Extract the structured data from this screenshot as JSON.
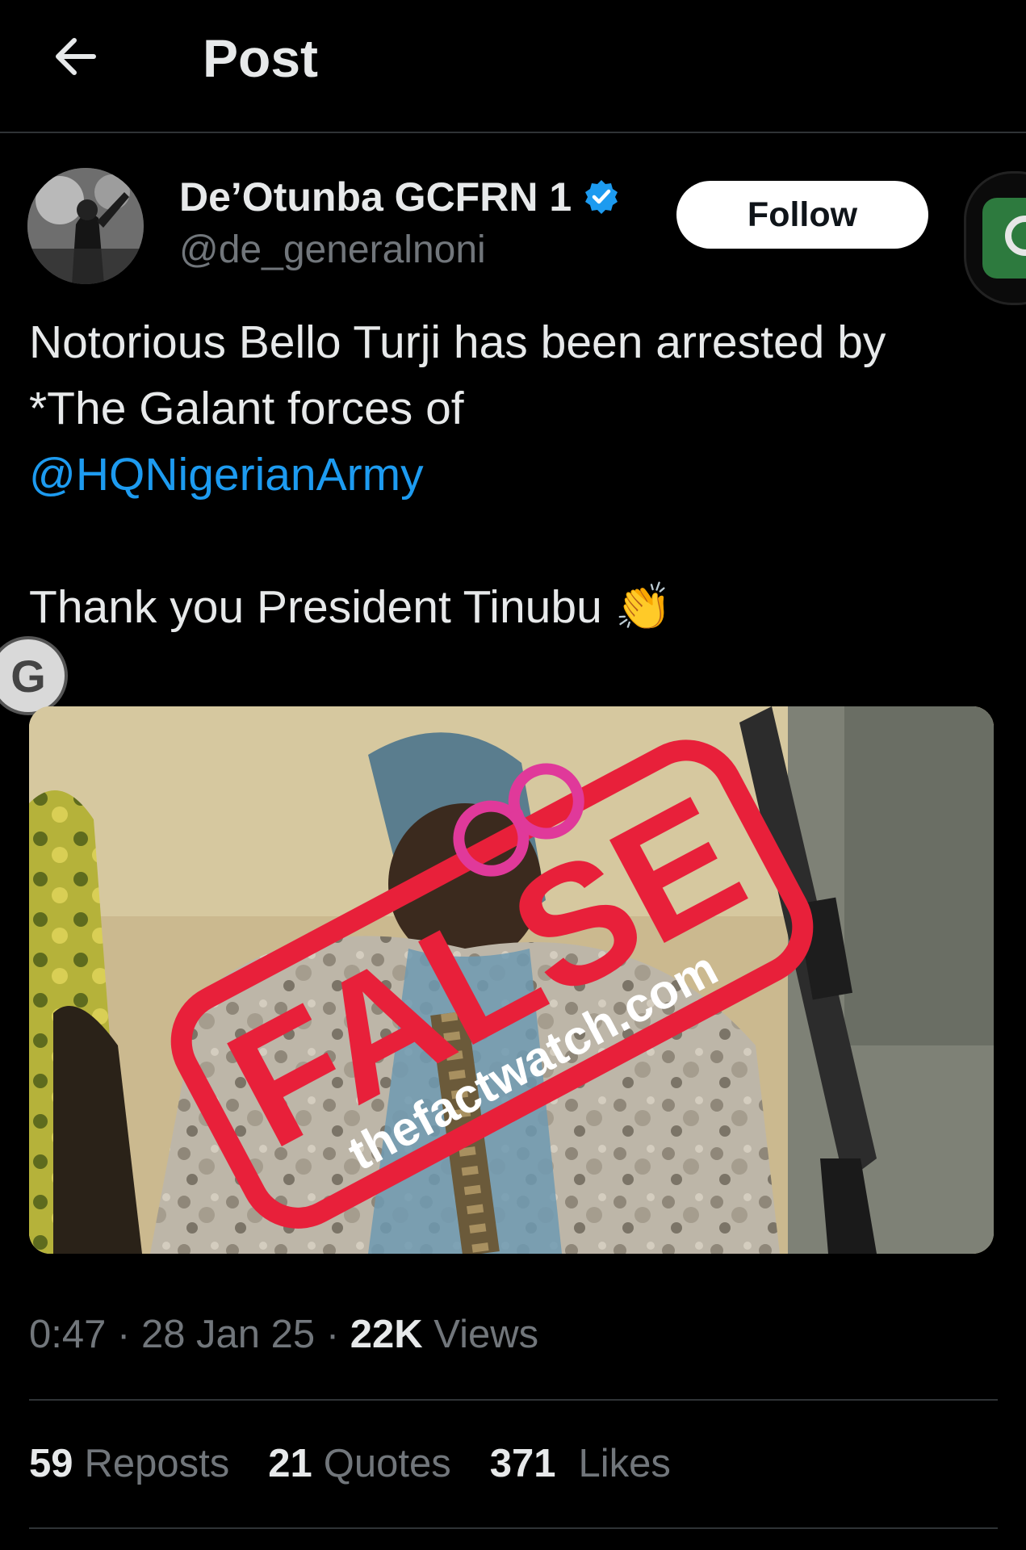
{
  "header": {
    "title": "Post",
    "back_icon": "arrow-left-icon"
  },
  "author": {
    "display_name": "De’Otunba GCFRN 1",
    "handle": "@de_generalnoni",
    "verified": true,
    "verified_color": "#1d9bf0",
    "follow_label": "Follow"
  },
  "tweet": {
    "line1": "Notorious Bello Turji has been arrested by *The Galant forces of",
    "mention": "@HQNigerianArmy",
    "line2": "Thank you President Tinubu 👏"
  },
  "media": {
    "stamp_word": "FALSE",
    "stamp_site": "thefactwatch.com",
    "stamp_color": "#e8203a",
    "handcuff_color": "#e0399a"
  },
  "side_badge": {
    "letter": "G"
  },
  "meta": {
    "time": "0:47",
    "date": "28 Jan 25",
    "views_count": "22K",
    "views_label": "Views"
  },
  "stats": {
    "reposts_count": "59",
    "reposts_label": "Reposts",
    "quotes_count": "21",
    "quotes_label": "Quotes",
    "likes_count": "371",
    "likes_label": "Likes"
  }
}
